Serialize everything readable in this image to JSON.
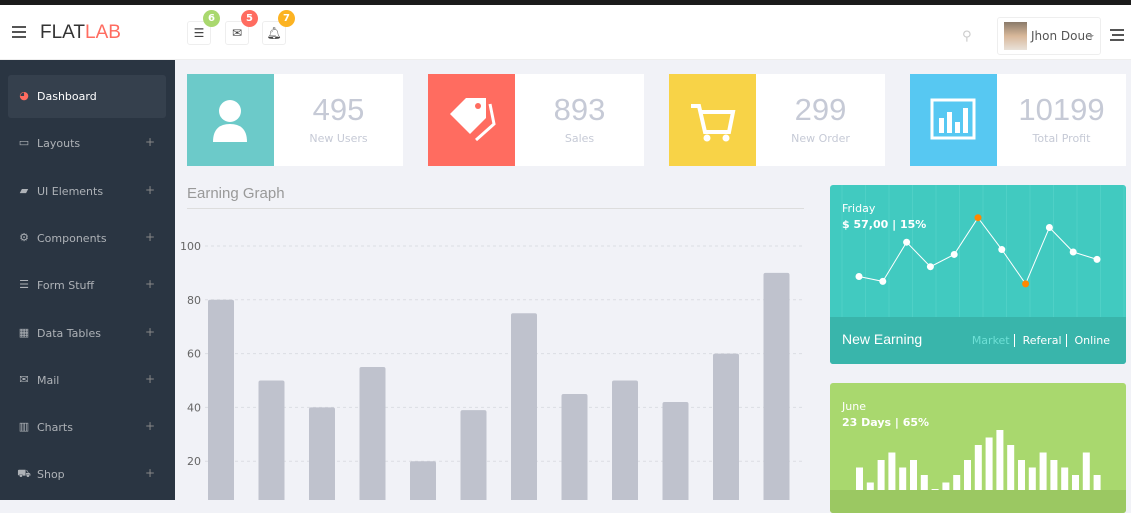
{
  "header": {
    "brand_a": "FLAT",
    "brand_b": "LAB",
    "notifications": [
      {
        "icon": "tasks-icon",
        "count": "6",
        "color": "#a9d86e"
      },
      {
        "icon": "envelope-icon",
        "count": "5",
        "color": "#ff6c60"
      },
      {
        "icon": "bell-icon",
        "count": "7",
        "color": "#fcb322"
      }
    ],
    "user": "Jhon Doue"
  },
  "sidebar": {
    "items": [
      {
        "label": "Dashboard",
        "icon": "dashboard-icon",
        "glyph": "◕"
      },
      {
        "label": "Layouts",
        "icon": "laptop-icon",
        "glyph": "▭"
      },
      {
        "label": "UI Elements",
        "icon": "book-icon",
        "glyph": "▰"
      },
      {
        "label": "Components",
        "icon": "cogs-icon",
        "glyph": "⚙"
      },
      {
        "label": "Form Stuff",
        "icon": "tasks-icon",
        "glyph": "☰"
      },
      {
        "label": "Data Tables",
        "icon": "th-icon",
        "glyph": "▦"
      },
      {
        "label": "Mail",
        "icon": "envelope-icon",
        "glyph": "✉"
      },
      {
        "label": "Charts",
        "icon": "bar-chart-icon",
        "glyph": "▥"
      },
      {
        "label": "Shop",
        "icon": "shopping-cart-icon",
        "glyph": "⛟"
      }
    ],
    "plus": "+"
  },
  "stats": [
    {
      "value": "495",
      "label": "New Users",
      "color": "#6ccac9",
      "icon": "user-icon"
    },
    {
      "value": "893",
      "label": "Sales",
      "color": "#ff6c60",
      "icon": "tags-icon"
    },
    {
      "value": "299",
      "label": "New Order",
      "color": "#f8d347",
      "icon": "shopping-cart-icon"
    },
    {
      "value": "10199",
      "label": "Total Profit",
      "color": "#57c8f2",
      "icon": "bar-chart-icon"
    }
  ],
  "earning": {
    "title": "Earning Graph"
  },
  "chart_data": [
    {
      "type": "bar",
      "title": "Earning Graph",
      "ylim": [
        0,
        100
      ],
      "yticks": [
        20,
        40,
        60,
        80,
        100
      ],
      "values": [
        80,
        50,
        40,
        55,
        20,
        39,
        75,
        45,
        50,
        42,
        60,
        90
      ],
      "grid": true,
      "color": "#bfc2cd"
    },
    {
      "type": "line",
      "values": [
        30,
        28,
        44,
        34,
        39,
        54,
        41,
        27,
        50,
        40,
        37
      ],
      "highlight": [
        5,
        7
      ],
      "color": "#ffffff",
      "highlight_color": "#ff8800"
    },
    {
      "type": "bar",
      "values": [
        3,
        1,
        4,
        5,
        3,
        4,
        2,
        0,
        1,
        2,
        4,
        6,
        7,
        8,
        6,
        4,
        3,
        5,
        4,
        3,
        2,
        5,
        2
      ],
      "color": "#ffffff"
    }
  ],
  "teal_card": {
    "day": "Friday",
    "summary": "$ 57,00 | 15%",
    "footer": "New Earning",
    "links": [
      "Market",
      "Referal",
      "Online"
    ]
  },
  "green_card": {
    "month": "June",
    "summary": "23 Days | 65%"
  }
}
